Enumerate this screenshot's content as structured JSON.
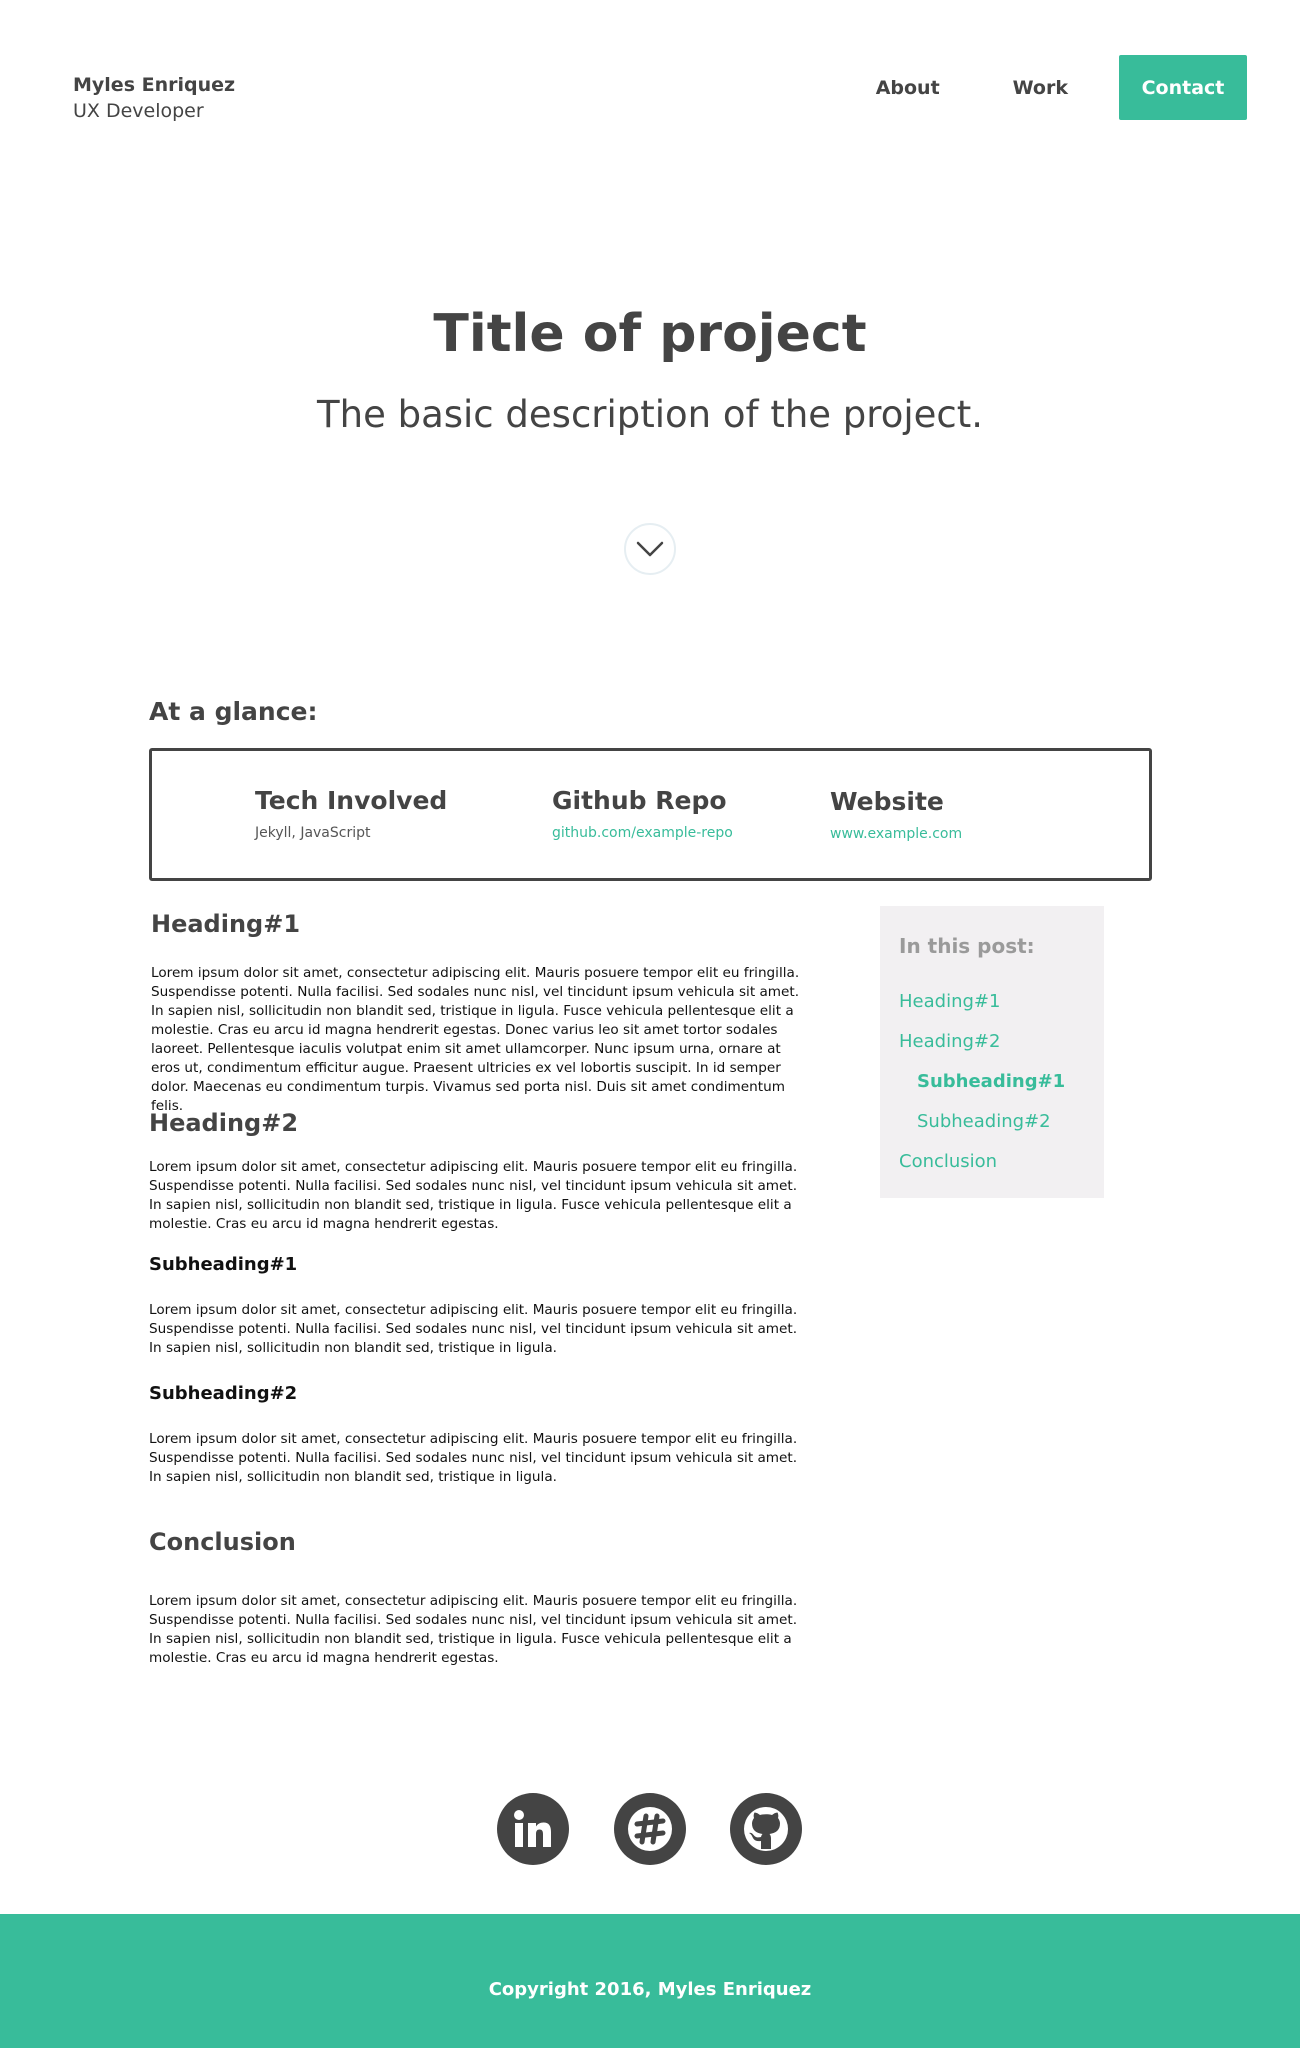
{
  "header": {
    "name": "Myles Enriquez",
    "role": "UX Developer",
    "nav": {
      "about": "About",
      "work": "Work",
      "contact": "Contact"
    }
  },
  "hero": {
    "title": "Title of project",
    "description": "The basic description of the project.",
    "scroll_icon": "chevron-down-icon"
  },
  "glance": {
    "heading": "At a glance:",
    "tech_title": "Tech Involved",
    "tech_value": "Jekyll, JavaScript",
    "repo_title": "Github Repo",
    "repo_value": "github.com/example-repo",
    "website_title": "Website",
    "website_value": "www.example.com"
  },
  "article": {
    "heading1": "Heading#1",
    "para1": "Lorem ipsum dolor sit amet, consectetur adipiscing elit. Mauris posuere tempor elit eu fringilla. Suspendisse potenti. Nulla facilisi. Sed sodales nunc nisl, vel tincidunt ipsum vehicula sit amet. In sapien nisl, sollicitudin non blandit sed, tristique in ligula. Fusce vehicula pellentesque elit a molestie. Cras eu arcu id magna hendrerit egestas. Donec varius leo sit amet tortor sodales laoreet. Pellentesque iaculis volutpat enim sit amet ullamcorper. Nunc ipsum urna, ornare at eros ut, condimentum efficitur augue. Praesent ultricies ex vel lobortis suscipit. In id semper dolor. Maecenas eu condimentum turpis. Vivamus sed porta nisl. Duis sit amet condimentum felis.",
    "heading2": "Heading#2",
    "para2": "Lorem ipsum dolor sit amet, consectetur adipiscing elit. Mauris posuere tempor elit eu fringilla. Suspendisse potenti. Nulla facilisi. Sed sodales nunc nisl, vel tincidunt ipsum vehicula sit amet. In sapien nisl, sollicitudin non blandit sed, tristique in ligula. Fusce vehicula pellentesque elit a molestie. Cras eu arcu id magna hendrerit egestas.",
    "subheading1": "Subheading#1",
    "para3": "Lorem ipsum dolor sit amet, consectetur adipiscing elit. Mauris posuere tempor elit eu fringilla. Suspendisse potenti. Nulla facilisi. Sed sodales nunc nisl, vel tincidunt ipsum vehicula sit amet. In sapien nisl, sollicitudin non blandit sed, tristique in ligula.",
    "subheading2": "Subheading#2",
    "para4": "Lorem ipsum dolor sit amet, consectetur adipiscing elit. Mauris posuere tempor elit eu fringilla. Suspendisse potenti. Nulla facilisi. Sed sodales nunc nisl, vel tincidunt ipsum vehicula sit amet. In sapien nisl, sollicitudin non blandit sed, tristique in ligula.",
    "conclusion": "Conclusion",
    "para5": "Lorem ipsum dolor sit amet, consectetur adipiscing elit. Mauris posuere tempor elit eu fringilla. Suspendisse potenti. Nulla facilisi. Sed sodales nunc nisl, vel tincidunt ipsum vehicula sit amet. In sapien nisl, sollicitudin non blandit sed, tristique in ligula. Fusce vehicula pellentesque elit a molestie. Cras eu arcu id magna hendrerit egestas."
  },
  "toc": {
    "title": "In this post:",
    "items": [
      "Heading#1",
      "Heading#2",
      "Subheading#1",
      "Subheading#2",
      "Conclusion"
    ],
    "active": "Subheading#1"
  },
  "social": {
    "icons": [
      "linkedin-icon",
      "slack-icon",
      "github-icon"
    ]
  },
  "footer": {
    "copyright": "Copyright 2016, Myles Enriquez"
  },
  "colors": {
    "accent": "#38bc9a",
    "text": "#444444",
    "toc_bg": "#f2f0f2"
  }
}
